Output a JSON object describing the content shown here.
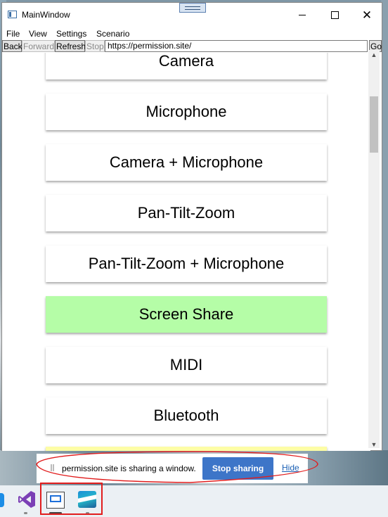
{
  "window": {
    "title": "MainWindow"
  },
  "menu": {
    "items": [
      "File",
      "View",
      "Settings",
      "Scenario"
    ]
  },
  "toolbar": {
    "back": "Back",
    "forward": "Forward",
    "refresh": "Refresh",
    "stop": "Stop",
    "address": "https://permission.site/",
    "go": "Go"
  },
  "permissions": [
    "Camera",
    "Microphone",
    "Camera + Microphone",
    "Pan-Tilt-Zoom",
    "Pan-Tilt-Zoom + Microphone",
    "Screen Share",
    "MIDI",
    "Bluetooth"
  ],
  "share_bar": {
    "message": "permission.site is sharing a window.",
    "stop_label": "Stop sharing",
    "hide_label": "Hide"
  },
  "colors": {
    "active_button": "#b5fda7",
    "partial_button": "#fdfda5",
    "stop_button": "#3d75c8",
    "annotation": "#e11d1d"
  }
}
